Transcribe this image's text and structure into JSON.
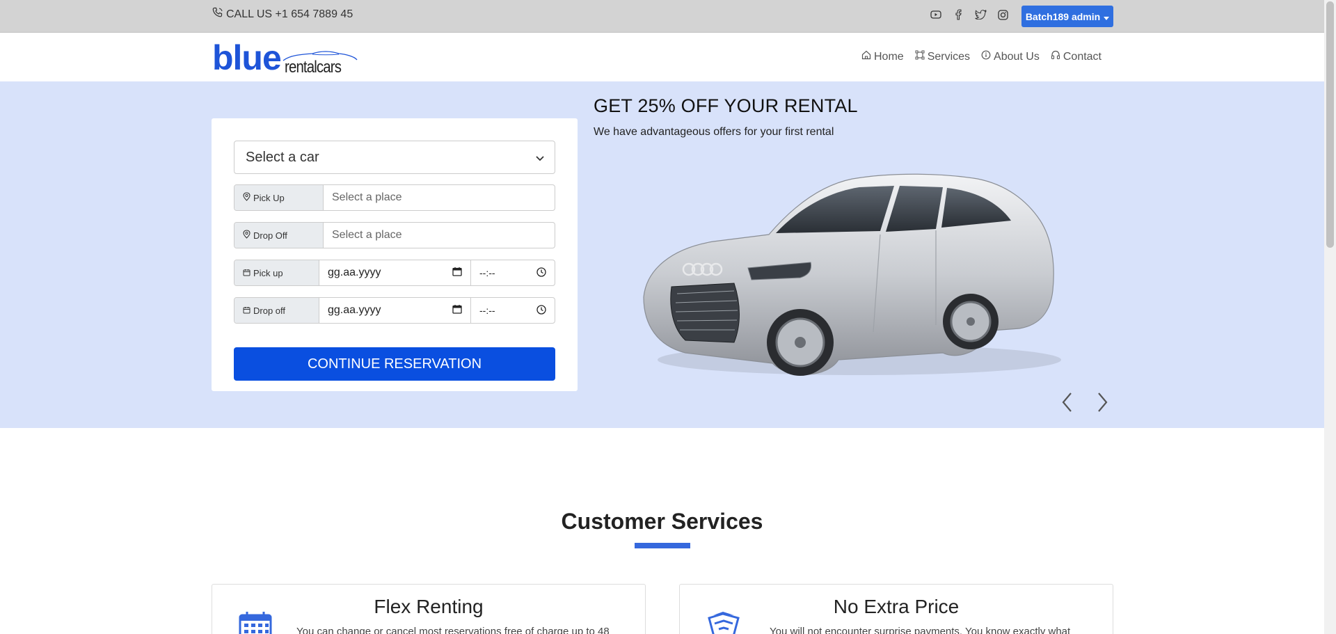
{
  "topbar": {
    "phone_text": "CALL US +1 654 7889 45",
    "socials": [
      "youtube-icon",
      "facebook-icon",
      "twitter-icon",
      "instagram-icon"
    ],
    "admin_label": "Batch189 admin"
  },
  "header": {
    "logo_primary": "blue",
    "logo_secondary": "rentalcars",
    "nav": [
      {
        "label": "Home",
        "icon": "home-icon"
      },
      {
        "label": "Services",
        "icon": "services-icon"
      },
      {
        "label": "About Us",
        "icon": "info-icon"
      },
      {
        "label": "Contact",
        "icon": "headset-icon"
      }
    ]
  },
  "reservation": {
    "car_select": "Select a car",
    "pickup_label": "Pick Up",
    "pickup_placeholder": "Select a place",
    "dropoff_label": "Drop Off",
    "dropoff_placeholder": "Select a place",
    "pickup_date_label": "Pick up",
    "pickup_date": "gg.aa.yyyy",
    "pickup_time": "--:--",
    "dropoff_date_label": "Drop off",
    "dropoff_date": "gg.aa.yyyy",
    "dropoff_time": "--:--",
    "continue_label": "CONTINUE RESERVATION"
  },
  "promo": {
    "title": "GET 25% OFF YOUR RENTAL",
    "subtitle": "We have advantageous offers for your first rental"
  },
  "services": {
    "title": "Customer Services",
    "cards": [
      {
        "title": "Flex Renting",
        "text": "You can change or cancel most reservations free of charge up to 48"
      },
      {
        "title": "No Extra Price",
        "text": "You will not encounter surprise payments. You know exactly what"
      }
    ]
  },
  "colors": {
    "accent": "#0a4fe0",
    "hero_bg": "#d8e2fa",
    "topbar_bg": "#d3d3d3"
  }
}
